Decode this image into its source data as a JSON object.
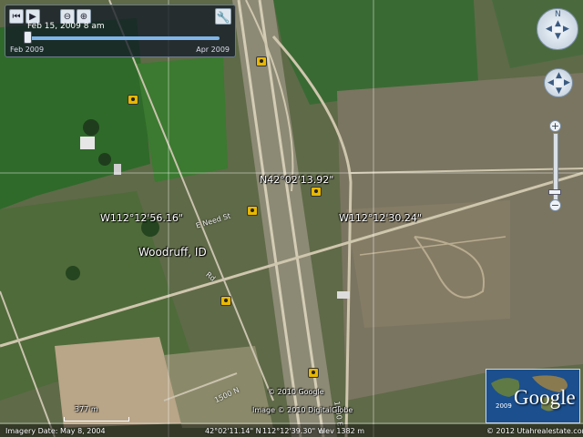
{
  "time_slider": {
    "current_date": "Feb 15, 2009  8 am",
    "start_label": "Feb 2009",
    "end_label": "Apr 2009",
    "position_fraction": 0.02
  },
  "labels": {
    "latitude": "N42°02'13.92\"",
    "longitude_left": "W112°12'56.16\"",
    "longitude_right": "W112°12'30.24\"",
    "place": "Woodruff, ID",
    "road_1": "E Need St",
    "road_2": "1000 E",
    "road_3": "Rd",
    "road_4": "1500 N"
  },
  "copyrights": {
    "google_2010": "© 2010 Google",
    "digitalglobe": "Image © 2010 DigitalGlobe",
    "utahrealestate": "© 2012 Utahrealestate.com"
  },
  "status": {
    "imagery_date": "Imagery Date: May 8, 2004",
    "lat": "42°02'11.14\" N",
    "lon": "112°12'39.30\" W",
    "elev": "elev  1382 m"
  },
  "scale": {
    "label": "377 m"
  },
  "overview": {
    "logo": "Google",
    "year": "2009"
  },
  "icons": {
    "photo": "camera-icon",
    "settings": "wrench-icon",
    "nav": "compass-icon"
  },
  "colors": {
    "field_green": "#2f6a2a",
    "dry_land": "#7a7560",
    "road": "#c9c2ae",
    "marker": "#e8b700"
  }
}
